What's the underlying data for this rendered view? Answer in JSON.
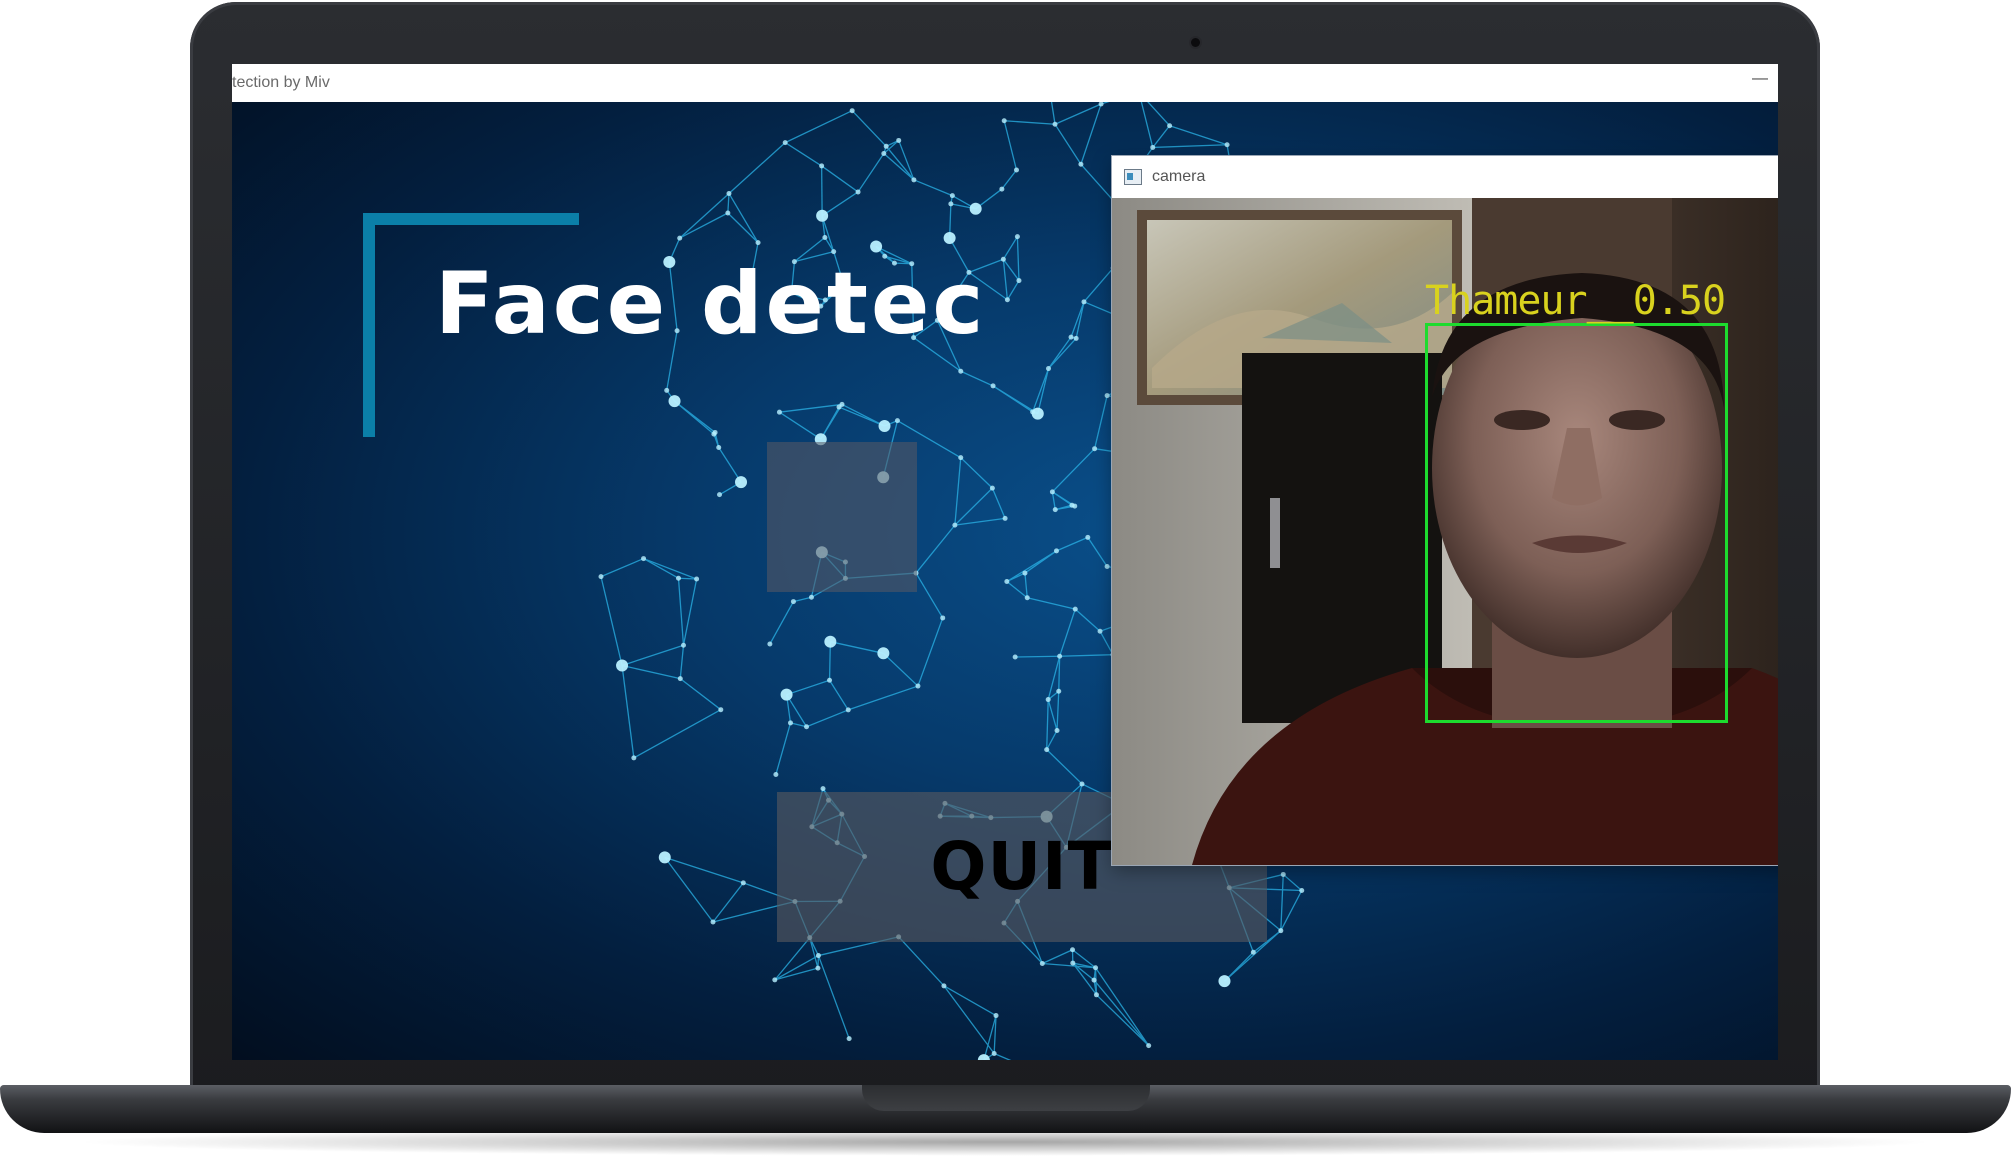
{
  "main_window": {
    "title": "tection by Miv",
    "minimize_glyph": "—",
    "page_title": "Face detec",
    "quit_label": "QUIT"
  },
  "camera_window": {
    "title": "camera",
    "icon": "app-window-icon",
    "minimize_glyph": "—",
    "maximize_glyph": "☐",
    "close_glyph": "✕",
    "detection": {
      "label": "Thameur__0.50",
      "box_color": "#1ddb2e",
      "label_color": "#d9d21e"
    }
  },
  "colors": {
    "mesh_line": "#2ab4e8",
    "mesh_node": "#b9f0ff",
    "title_bracket": "#0b7fa8",
    "background_dark": "#031f3f"
  }
}
